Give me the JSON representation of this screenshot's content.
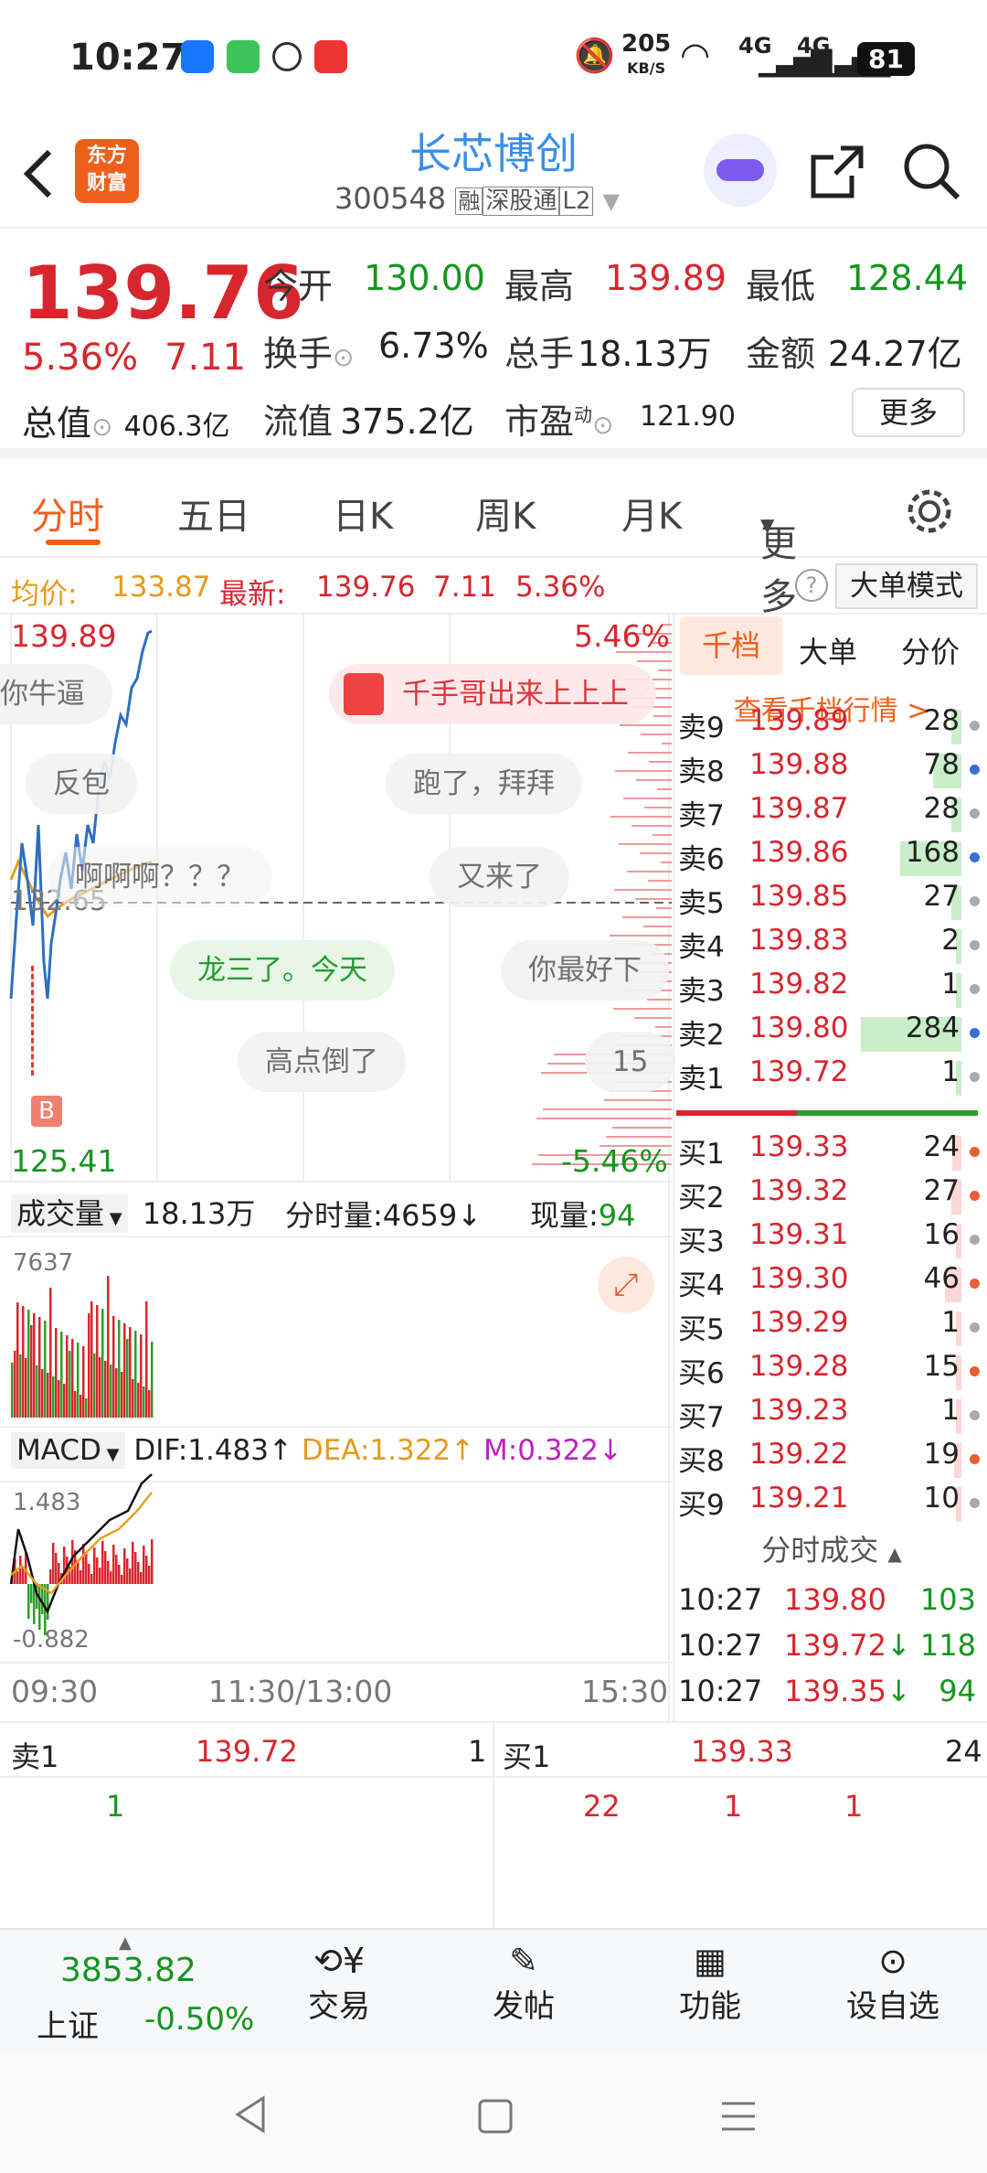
{
  "status": {
    "time": "10:27",
    "speed_top": "205",
    "speed_bottom": "KB/S",
    "net1": "4G",
    "net2": "4G",
    "battery": "81"
  },
  "header": {
    "logo_top": "东方",
    "logo_bottom": "财富",
    "stock_name": "长芯博创",
    "code": "300548",
    "tag1": "融",
    "tag2": "深股通",
    "tag3": "L2"
  },
  "quote": {
    "price": "139.76",
    "pct": "5.36%",
    "change": "7.11",
    "open_label": "今开",
    "open": "130.00",
    "high_label": "最高",
    "high": "139.89",
    "low_label": "最低",
    "low": "128.44",
    "turnover_label": "换手",
    "turnover": "6.73%",
    "volume_label": "总手",
    "volume": "18.13万",
    "amount_label": "金额",
    "amount": "24.27亿",
    "mcap_label": "总值",
    "mcap": "406.3亿",
    "float_label": "流值",
    "float": "375.2亿",
    "pe_label": "市盈",
    "pe_sup": "动",
    "pe": "121.90",
    "more": "更多"
  },
  "tabs": [
    "分时",
    "五日",
    "日K",
    "周K",
    "月K",
    "更多"
  ],
  "avgbar": {
    "avg_label": "均价:",
    "avg": "133.87",
    "last_label": "最新:",
    "last": "139.76",
    "chg": "7.11",
    "pct": "5.36%",
    "mode": "大单模式"
  },
  "chart": {
    "ymax": "139.89",
    "ymin": "125.41",
    "pct_top": "5.46%",
    "pct_bot": "-5.46%",
    "mid": "132.65",
    "b_marker": "B",
    "vol_label": "成交量",
    "vol_total": "18.13万",
    "fenshi_vol": "分时量:4659↓",
    "cur_vol_label": "现量:",
    "cur_vol": "94",
    "vol_max": "7637",
    "macd_label": "MACD",
    "dif": "DIF:1.483↑",
    "dea": "DEA:1.322↑",
    "m": "M:0.322↓",
    "macd_max": "1.483",
    "macd_min": "-0.882",
    "t1": "09:30",
    "t2": "11:30/13:00",
    "t3": "15:30"
  },
  "bubbles": [
    "你牛逼",
    "千手哥出来上上上",
    "反包",
    "跑了，拜拜",
    "啊啊啊？？？",
    "又来了",
    "龙三了。今天",
    "你最好下",
    "高点倒了",
    "15"
  ],
  "orderbook": {
    "tabs": [
      "千档",
      "大单",
      "分价"
    ],
    "link": "查看千档行情 >",
    "sells": [
      [
        "卖9",
        "139.89",
        "28"
      ],
      [
        "卖8",
        "139.88",
        "78"
      ],
      [
        "卖7",
        "139.87",
        "28"
      ],
      [
        "卖6",
        "139.86",
        "168"
      ],
      [
        "卖5",
        "139.85",
        "27"
      ],
      [
        "卖4",
        "139.83",
        "2"
      ],
      [
        "卖3",
        "139.82",
        "1"
      ],
      [
        "卖2",
        "139.80",
        "284"
      ],
      [
        "卖1",
        "139.72",
        "1"
      ]
    ],
    "buys": [
      [
        "买1",
        "139.33",
        "24"
      ],
      [
        "买2",
        "139.32",
        "27"
      ],
      [
        "买3",
        "139.31",
        "16"
      ],
      [
        "买4",
        "139.30",
        "46"
      ],
      [
        "买5",
        "139.29",
        "1"
      ],
      [
        "买6",
        "139.28",
        "15"
      ],
      [
        "买7",
        "139.23",
        "1"
      ],
      [
        "买8",
        "139.22",
        "19"
      ],
      [
        "买9",
        "139.21",
        "10"
      ]
    ],
    "ticks_title": "分时成交",
    "ticks": [
      [
        "10:27",
        "139.80",
        "103",
        ""
      ],
      [
        "10:27",
        "139.72",
        "118",
        "↓"
      ],
      [
        "10:27",
        "139.35",
        "94",
        "↓"
      ]
    ]
  },
  "bottom_quote": {
    "sell_label": "卖1",
    "sell_price": "139.72",
    "sell_qty": "1",
    "buy_label": "买1",
    "buy_price": "139.33",
    "buy_qty": "24",
    "q1": "1",
    "q2": "22",
    "q3": "1",
    "q4": "1"
  },
  "bottom": {
    "index_value": "3853.82",
    "index_name": "上证",
    "index_pct": "-0.50%",
    "items": [
      "交易",
      "发帖",
      "功能",
      "设自选"
    ]
  }
}
